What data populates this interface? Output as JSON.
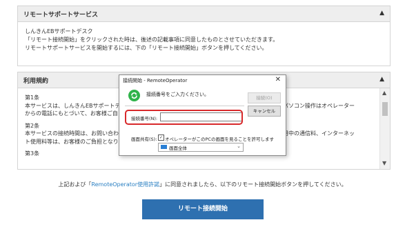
{
  "remote_panel": {
    "title": "リモートサポートサービス",
    "lines": [
      "しんきんEBサポートデスク",
      "「リモート接続開始」をクリックされた時は、後述の記載事項に同意したものとさせていただきます。",
      "リモートサポートサービスを開始するには、下の「リモート接続開始」ボタンを押してください。"
    ]
  },
  "terms_panel": {
    "title": "利用規約",
    "art1_title": "第1条",
    "art1_l1": "本サービスは、しんきんEBサポートデ",
    "art1_l1_right": "際のパソコン操作はオペレーター",
    "art1_l2": "からの電話にもとづいて、お客様ご自",
    "art2_title": "第2条",
    "art2_l1": "本サービスの接続時間は、お問い合わ",
    "art2_l1_right": "ご利用中の通信料、インターネッ",
    "art2_l2": "ト使用料等は、お客様のご負担となり",
    "art3_title": "第3条"
  },
  "agreement": {
    "prefix": "上記および「",
    "link": "RemoteOperator使用許諾",
    "suffix": "」に同意されましたら、以下のリモート接続開始ボタンを押してください。"
  },
  "connect_button": "リモート接続開始",
  "dialog": {
    "title": "接続開始 - RemoteOperator",
    "close": "✕",
    "prompt": "接続番号をご入力ください。",
    "ok": "接続(O)",
    "cancel": "キャンセル",
    "number_label": "接続番号(N):",
    "number_value": "",
    "share_label": "画面共有(S):",
    "share_check": "✓",
    "share_check_label": "オペレーターがこのPCの画面を見ることを許可します",
    "screen_select": "画面全体"
  },
  "colors": {
    "accent": "#2e70b0",
    "link": "#2a7fc2",
    "highlight": "#d8282a",
    "logo": "#2fb34a"
  }
}
